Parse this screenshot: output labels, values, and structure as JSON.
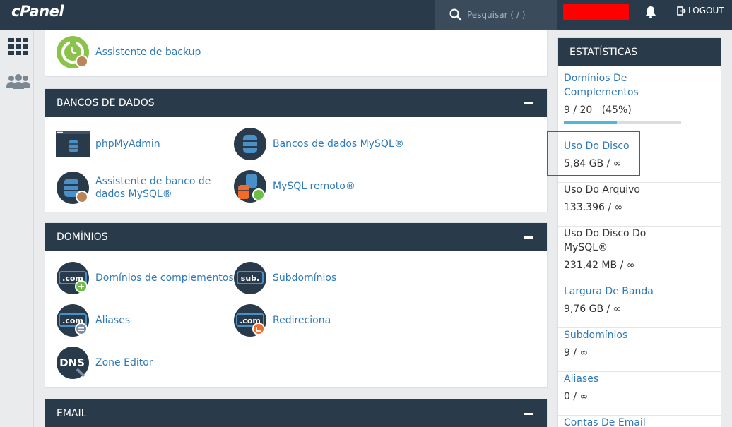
{
  "header": {
    "logo": "cPanel",
    "search_placeholder": "Pesquisar ( / )",
    "logout": "LOGOUT"
  },
  "sections": {
    "top": {
      "tools": [
        {
          "label": "Assistente de backup",
          "icon": "backup-wizard-icon"
        }
      ]
    },
    "databases": {
      "title": "BANCOS DE DADOS",
      "tools": [
        {
          "label": "phpMyAdmin",
          "icon": "phpmyadmin-icon"
        },
        {
          "label": "Bancos de dados MySQL®",
          "icon": "mysql-databases-icon"
        },
        {
          "label": "Assistente de banco de dados MySQL®",
          "icon": "mysql-wizard-icon"
        },
        {
          "label": "MySQL remoto®",
          "icon": "remote-mysql-icon"
        }
      ]
    },
    "domains": {
      "title": "DOMÍNIOS",
      "tools": [
        {
          "label": "Domínios de complementos",
          "icon": "addon-domains-icon"
        },
        {
          "label": "Subdomínios",
          "icon": "subdomains-icon"
        },
        {
          "label": "Aliases",
          "icon": "aliases-icon"
        },
        {
          "label": "Redireciona",
          "icon": "redirects-icon"
        },
        {
          "label": "Zone Editor",
          "icon": "zone-editor-icon"
        }
      ]
    },
    "email": {
      "title": "EMAIL"
    }
  },
  "stats": {
    "title": "ESTATÍSTICAS",
    "items": [
      {
        "name": "Domínios De Complementos",
        "value": "9 / 20   (45%)",
        "progress": 0.45,
        "link": true
      },
      {
        "name": "Uso Do Disco",
        "value": "5,84 GB / ∞",
        "link": true
      },
      {
        "name": "Uso Do Arquivo",
        "value": "133.396 / ∞",
        "link": false
      },
      {
        "name": "Uso Do Disco Do MySQL®",
        "value": "231,42 MB / ∞",
        "link": false
      },
      {
        "name": "Largura De Banda",
        "value": "9,76 GB / ∞",
        "link": true
      },
      {
        "name": "Subdomínios",
        "value": "9 / ∞",
        "link": true
      },
      {
        "name": "Aliases",
        "value": "0 / ∞",
        "link": true
      },
      {
        "name": "Contas De Email",
        "value": "",
        "link": true
      }
    ]
  },
  "colors": {
    "navy": "#293a4a",
    "link": "#2e7ab8",
    "highlight": "#d9232d",
    "progress": "#4fb8d8"
  }
}
